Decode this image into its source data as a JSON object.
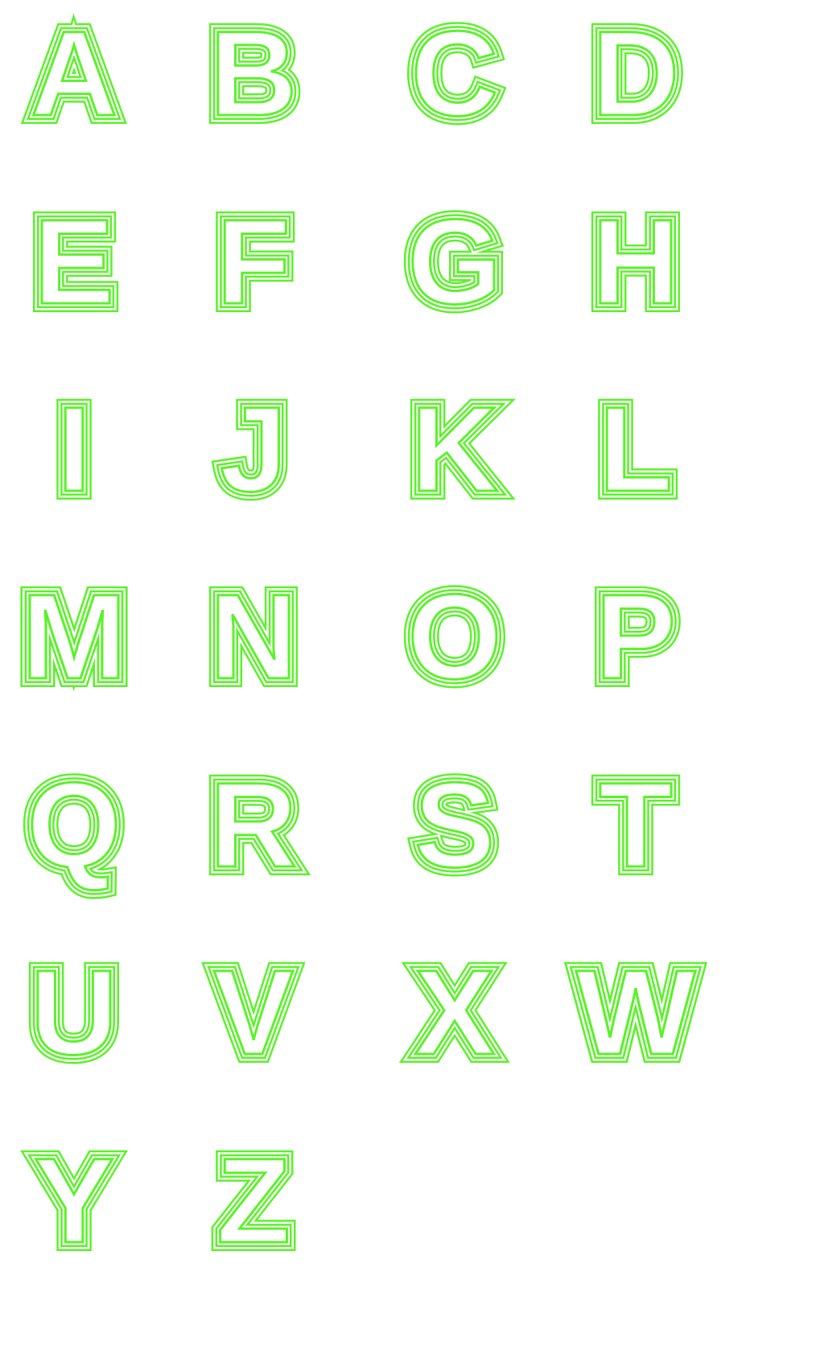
{
  "accent_color": "#5af229",
  "background_color": "#ffffff",
  "letters": [
    [
      "A",
      "B",
      "C",
      "D"
    ],
    [
      "E",
      "F",
      "G",
      "H"
    ],
    [
      "I",
      "J",
      "K",
      "L"
    ],
    [
      "M",
      "N",
      "O",
      "P"
    ],
    [
      "Q",
      "R",
      "S",
      "T"
    ],
    [
      "U",
      "V",
      "X",
      "W"
    ],
    [
      "Y",
      "Z"
    ]
  ]
}
